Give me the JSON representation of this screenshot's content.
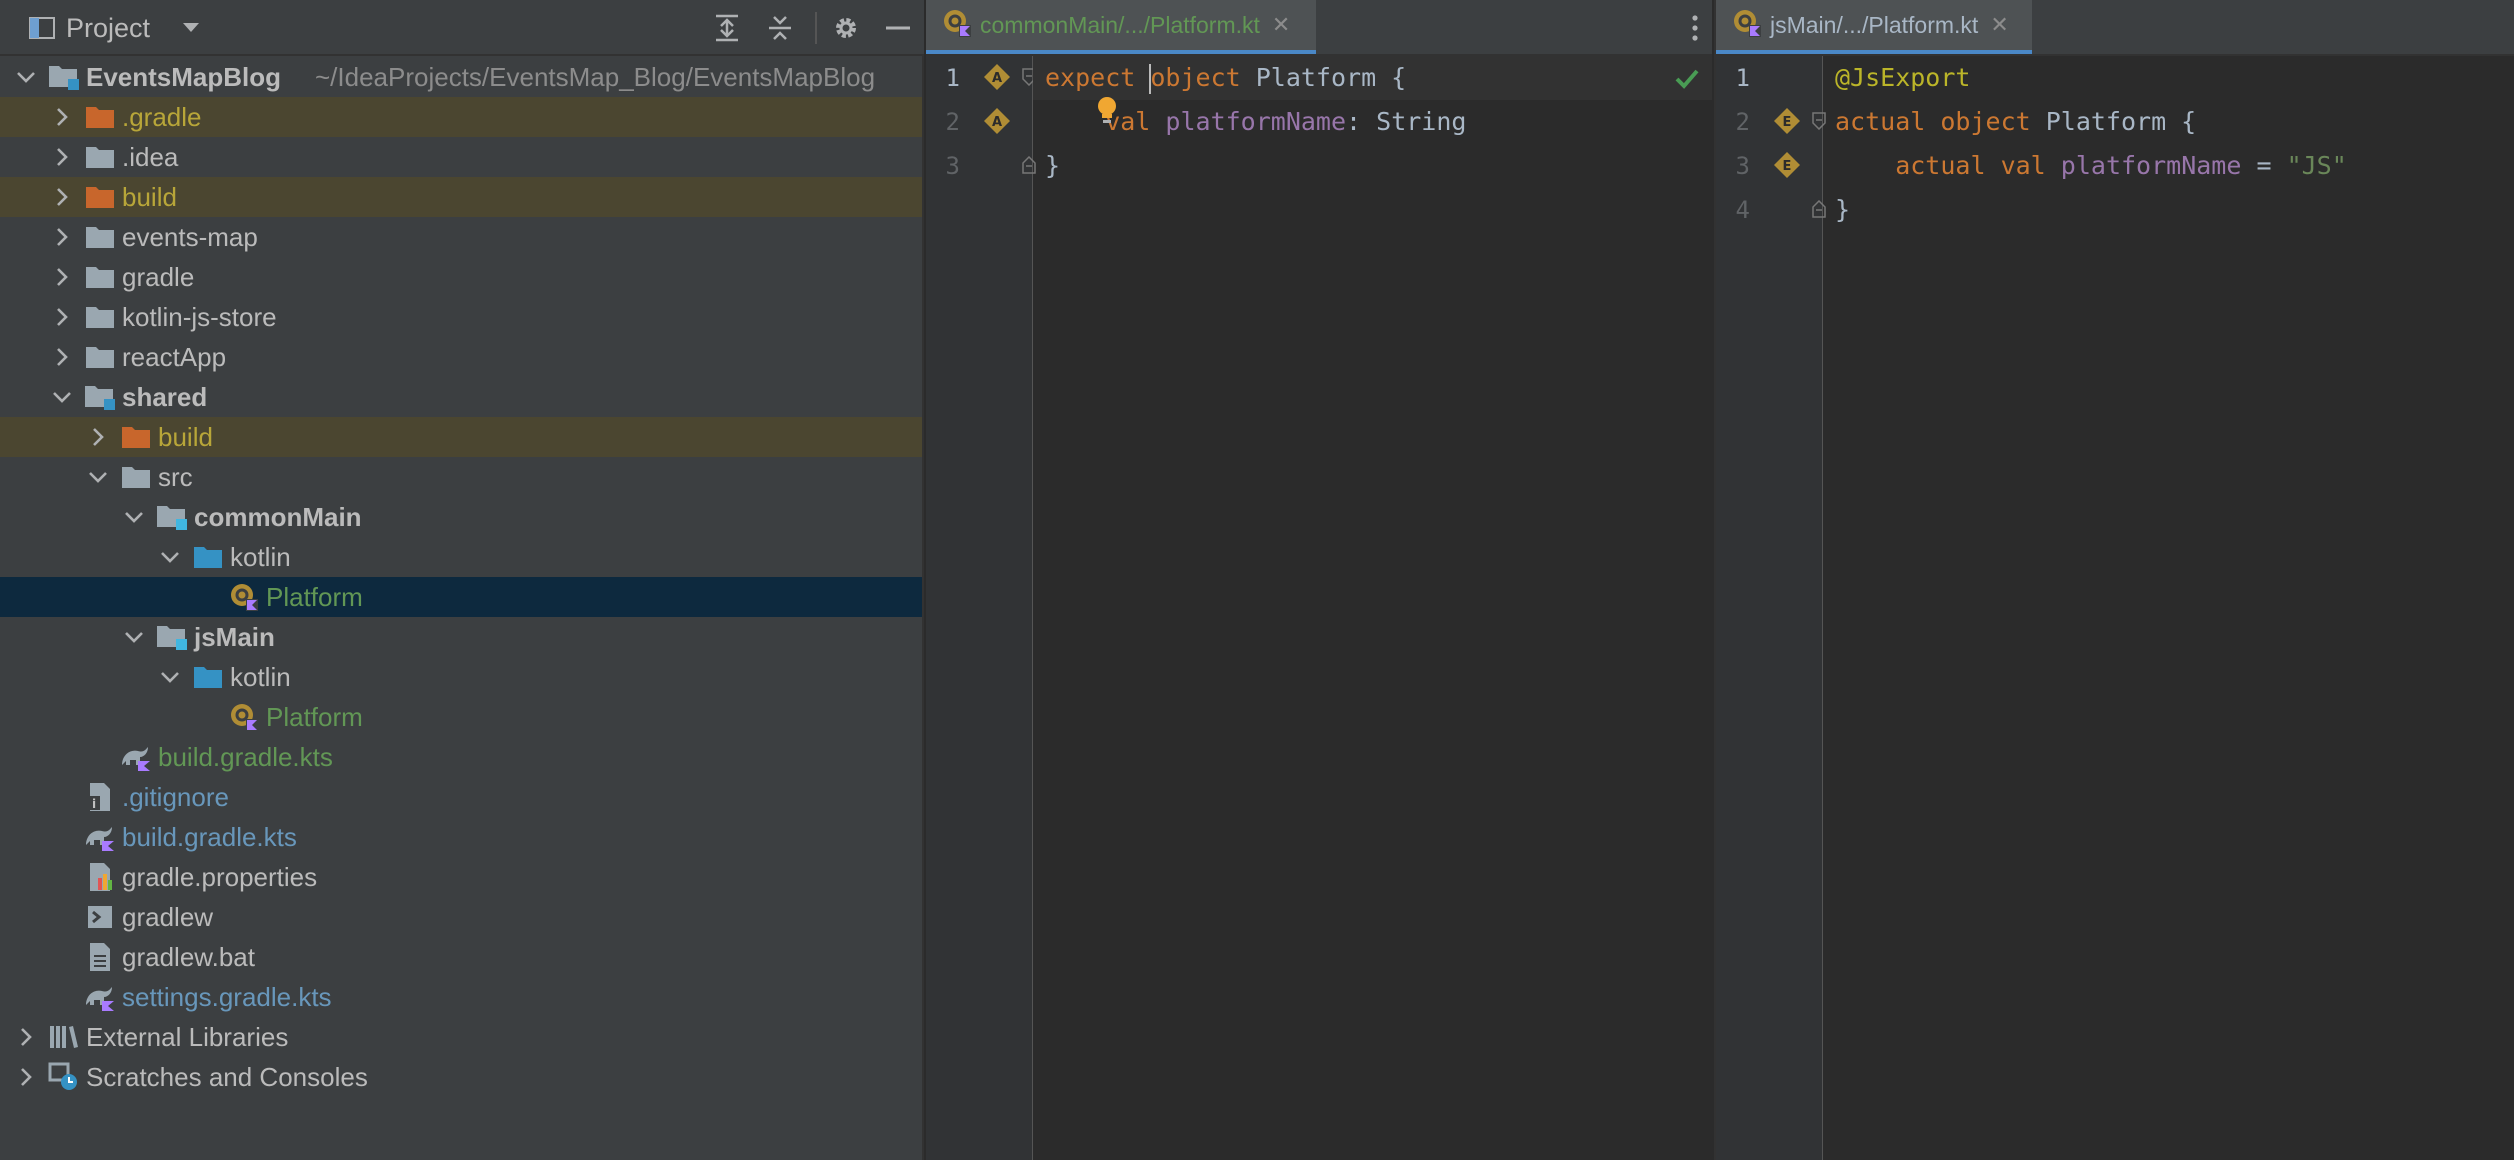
{
  "project_panel": {
    "title": "Project",
    "tree": [
      {
        "label": "EventsMapBlog",
        "path": "~/IdeaProjects/EventsMap_Blog/EventsMapBlog",
        "depth": 0,
        "chevron": "down",
        "icon": "module-folder-icon",
        "color": "default",
        "bold": true,
        "excluded": false
      },
      {
        "label": ".gradle",
        "depth": 1,
        "chevron": "right",
        "icon": "excluded-folder-icon",
        "color": "excl",
        "excluded": true
      },
      {
        "label": ".idea",
        "depth": 1,
        "chevron": "right",
        "icon": "folder-icon",
        "color": "default"
      },
      {
        "label": "build",
        "depth": 1,
        "chevron": "right",
        "icon": "excluded-folder-icon",
        "color": "excl",
        "excluded": true
      },
      {
        "label": "events-map",
        "depth": 1,
        "chevron": "right",
        "icon": "folder-icon",
        "color": "default"
      },
      {
        "label": "gradle",
        "depth": 1,
        "chevron": "right",
        "icon": "folder-icon",
        "color": "default"
      },
      {
        "label": "kotlin-js-store",
        "depth": 1,
        "chevron": "right",
        "icon": "folder-icon",
        "color": "default"
      },
      {
        "label": "reactApp",
        "depth": 1,
        "chevron": "right",
        "icon": "folder-icon",
        "color": "default"
      },
      {
        "label": "shared",
        "depth": 1,
        "chevron": "down",
        "icon": "module-folder-icon",
        "color": "default",
        "bold": true
      },
      {
        "label": "build",
        "depth": 2,
        "chevron": "right",
        "icon": "excluded-folder-icon",
        "color": "excl",
        "excluded": true
      },
      {
        "label": "src",
        "depth": 2,
        "chevron": "down",
        "icon": "folder-icon",
        "color": "default"
      },
      {
        "label": "commonMain",
        "depth": 3,
        "chevron": "down",
        "icon": "source-set-folder-icon",
        "color": "default",
        "bold": true
      },
      {
        "label": "kotlin",
        "depth": 4,
        "chevron": "down",
        "icon": "source-root-folder-icon",
        "color": "default"
      },
      {
        "label": "Platform",
        "depth": 5,
        "chevron": "none",
        "icon": "kotlin-object-icon",
        "color": "green",
        "selected": true
      },
      {
        "label": "jsMain",
        "depth": 3,
        "chevron": "down",
        "icon": "source-set-folder-icon",
        "color": "default",
        "bold": true
      },
      {
        "label": "kotlin",
        "depth": 4,
        "chevron": "down",
        "icon": "source-root-folder-icon",
        "color": "default"
      },
      {
        "label": "Platform",
        "depth": 5,
        "chevron": "none",
        "icon": "kotlin-object-icon",
        "color": "green"
      },
      {
        "label": "build.gradle.kts",
        "depth": 2,
        "chevron": "none",
        "icon": "gradle-icon",
        "color": "green"
      },
      {
        "label": ".gitignore",
        "depth": 1,
        "chevron": "none",
        "icon": "gitignore-icon",
        "color": "blue"
      },
      {
        "label": "build.gradle.kts",
        "depth": 1,
        "chevron": "none",
        "icon": "gradle-icon",
        "color": "blue"
      },
      {
        "label": "gradle.properties",
        "depth": 1,
        "chevron": "none",
        "icon": "properties-icon",
        "color": "default"
      },
      {
        "label": "gradlew",
        "depth": 1,
        "chevron": "none",
        "icon": "shell-script-icon",
        "color": "default"
      },
      {
        "label": "gradlew.bat",
        "depth": 1,
        "chevron": "none",
        "icon": "text-file-icon",
        "color": "default"
      },
      {
        "label": "settings.gradle.kts",
        "depth": 1,
        "chevron": "none",
        "icon": "gradle-icon",
        "color": "blue"
      },
      {
        "label": "External Libraries",
        "depth": 0,
        "chevron": "right",
        "icon": "libraries-icon",
        "color": "default"
      },
      {
        "label": "Scratches and Consoles",
        "depth": 0,
        "chevron": "right",
        "icon": "scratches-icon",
        "color": "default"
      }
    ]
  },
  "editor_left": {
    "tab_label": "commonMain/.../Platform.kt",
    "tab_close": "✕",
    "line_numbers": [
      "1",
      "2",
      "3"
    ],
    "lines": [
      [
        {
          "t": "expect ",
          "c": "kw"
        },
        {
          "t": "",
          "c": "caret"
        },
        {
          "t": "object ",
          "c": "kw"
        },
        {
          "t": "Platform {",
          "c": "id"
        }
      ],
      [
        {
          "t": "    val ",
          "c": "kw"
        },
        {
          "t": "platformName",
          "c": "prop"
        },
        {
          "t": ": String",
          "c": "id"
        }
      ],
      [
        {
          "t": "}",
          "c": "id"
        }
      ]
    ]
  },
  "editor_right": {
    "tab_label": "jsMain/.../Platform.kt",
    "tab_close": "✕",
    "line_numbers": [
      "1",
      "2",
      "3",
      "4"
    ],
    "lines": [
      [
        {
          "t": "@JsExport",
          "c": "ann"
        }
      ],
      [
        {
          "t": "actual ",
          "c": "kw"
        },
        {
          "t": "object ",
          "c": "kw"
        },
        {
          "t": "Platform {",
          "c": "id"
        }
      ],
      [
        {
          "t": "    actual ",
          "c": "kw"
        },
        {
          "t": "val ",
          "c": "kw"
        },
        {
          "t": "platformName",
          "c": "prop"
        },
        {
          "t": " = ",
          "c": "id"
        },
        {
          "t": "\"JS\"",
          "c": "str"
        }
      ],
      [
        {
          "t": "}",
          "c": "id"
        }
      ]
    ]
  },
  "colors": {
    "panel_bg": "#3c3f41",
    "editor_bg": "#2b2b2b",
    "selection": "#0d293e",
    "excluded_bg": "#4b4630",
    "keyword": "#cc7832",
    "property": "#9876aa",
    "string": "#6a8759",
    "annotation": "#bbb529",
    "green_file": "#629755",
    "blue_file": "#6897bb"
  }
}
